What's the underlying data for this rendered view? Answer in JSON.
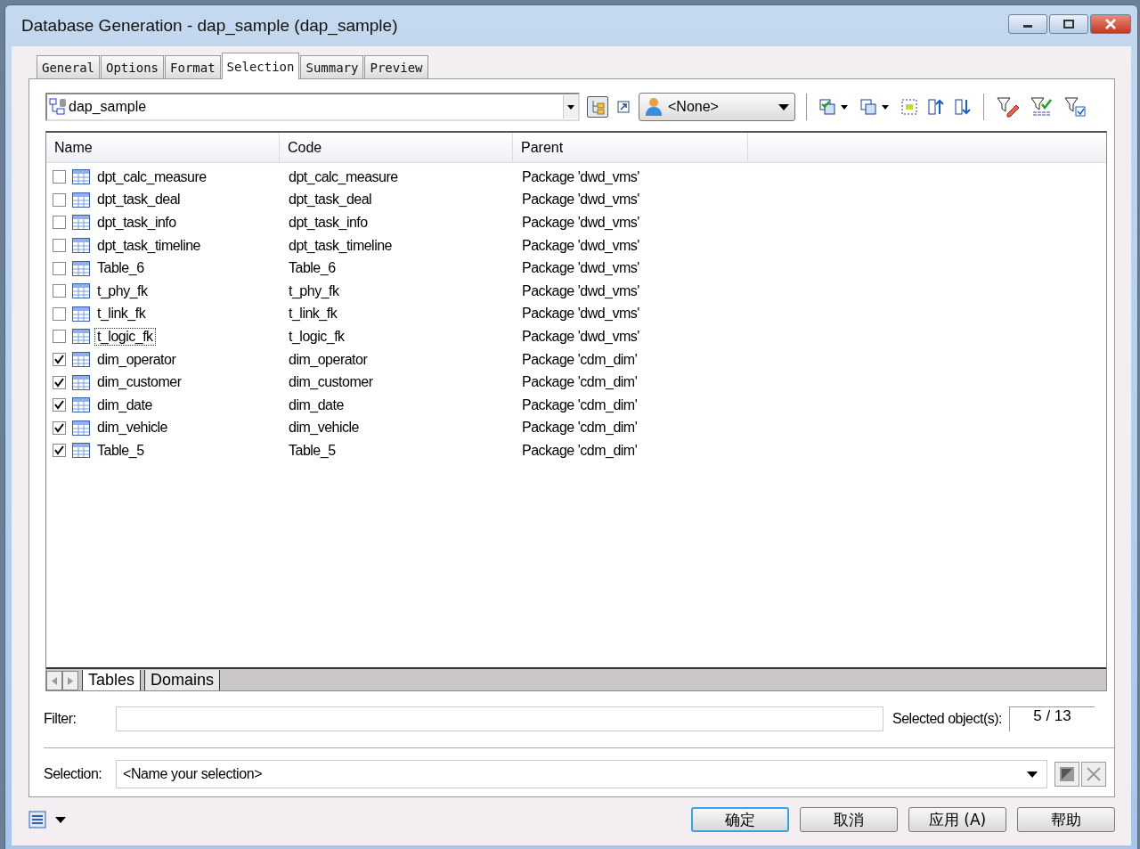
{
  "window": {
    "title": "Database Generation - dap_sample (dap_sample)"
  },
  "tabs": [
    {
      "label": "General",
      "selected": false
    },
    {
      "label": "Options",
      "selected": false
    },
    {
      "label": "Format",
      "selected": false
    },
    {
      "label": "Selection",
      "selected": true
    },
    {
      "label": "Summary",
      "selected": false
    },
    {
      "label": "Preview",
      "selected": false
    }
  ],
  "model_combo": {
    "value": "dap_sample"
  },
  "owner_combo": {
    "value": "<None>"
  },
  "table": {
    "columns": [
      "Name",
      "Code",
      "Parent"
    ],
    "rows": [
      {
        "name": "dpt_calc_measure",
        "code": "dpt_calc_measure",
        "parent": "Package 'dwd_vms'",
        "checked": false,
        "focused": false
      },
      {
        "name": "dpt_task_deal",
        "code": "dpt_task_deal",
        "parent": "Package 'dwd_vms'",
        "checked": false,
        "focused": false
      },
      {
        "name": "dpt_task_info",
        "code": "dpt_task_info",
        "parent": "Package 'dwd_vms'",
        "checked": false,
        "focused": false
      },
      {
        "name": "dpt_task_timeline",
        "code": "dpt_task_timeline",
        "parent": "Package 'dwd_vms'",
        "checked": false,
        "focused": false
      },
      {
        "name": "Table_6",
        "code": "Table_6",
        "parent": "Package 'dwd_vms'",
        "checked": false,
        "focused": false
      },
      {
        "name": "t_phy_fk",
        "code": "t_phy_fk",
        "parent": "Package 'dwd_vms'",
        "checked": false,
        "focused": false
      },
      {
        "name": "t_link_fk",
        "code": "t_link_fk",
        "parent": "Package 'dwd_vms'",
        "checked": false,
        "focused": false
      },
      {
        "name": "t_logic_fk",
        "code": "t_logic_fk",
        "parent": "Package 'dwd_vms'",
        "checked": false,
        "focused": true
      },
      {
        "name": "dim_operator",
        "code": "dim_operator",
        "parent": "Package 'cdm_dim'",
        "checked": true,
        "focused": false
      },
      {
        "name": "dim_customer",
        "code": "dim_customer",
        "parent": "Package 'cdm_dim'",
        "checked": true,
        "focused": false
      },
      {
        "name": "dim_date",
        "code": "dim_date",
        "parent": "Package 'cdm_dim'",
        "checked": true,
        "focused": false
      },
      {
        "name": "dim_vehicle",
        "code": "dim_vehicle",
        "parent": "Package 'cdm_dim'",
        "checked": true,
        "focused": false
      },
      {
        "name": "Table_5",
        "code": "Table_5",
        "parent": "Package 'cdm_dim'",
        "checked": true,
        "focused": false
      }
    ]
  },
  "sheet_tabs": [
    {
      "label": "Tables",
      "selected": true
    },
    {
      "label": "Domains",
      "selected": false
    }
  ],
  "filter": {
    "label": "Filter:"
  },
  "selected_count": {
    "label": "Selected object(s):",
    "value": "5 / 13"
  },
  "selection": {
    "label": "Selection:",
    "value": "<Name your selection>"
  },
  "buttons": [
    {
      "label": "确定",
      "default": true
    },
    {
      "label": "取消",
      "default": false
    },
    {
      "label": "应用 (A)",
      "default": false
    },
    {
      "label": "帮助",
      "default": false
    }
  ]
}
